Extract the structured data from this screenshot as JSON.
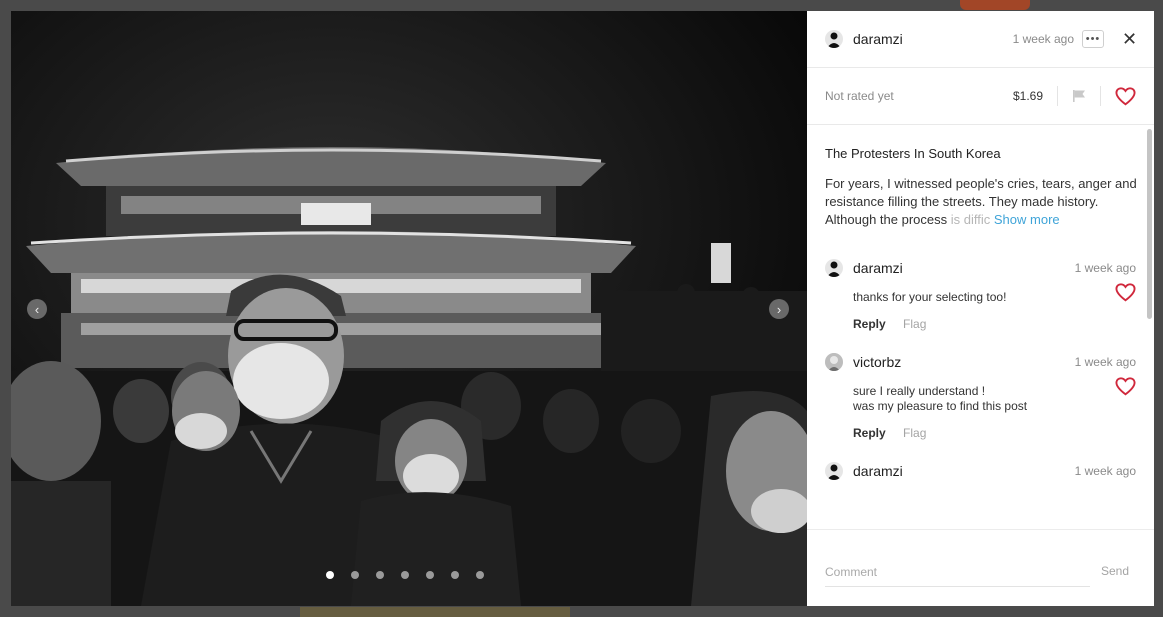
{
  "header": {
    "username": "daramzi",
    "time": "1 week ago",
    "more_label": "•••",
    "close_label": "✕"
  },
  "stats": {
    "rating": "Not rated yet",
    "price": "$1.69"
  },
  "photo": {
    "title": "The Protesters In South Korea",
    "description_visible": "For years, I witnessed people's cries, tears, anger and resistance filling the streets. They made history. Although the process ",
    "description_faded": "is diffic",
    "show_more": "Show more",
    "slide_count": 7,
    "active_slide": 1,
    "prev_label": "‹",
    "next_label": "›"
  },
  "comments": [
    {
      "username": "daramzi",
      "time": "1 week ago",
      "lines": [
        "thanks for your selecting too!"
      ],
      "reply_label": "Reply",
      "flag_label": "Flag"
    },
    {
      "username": "victorbz",
      "time": "1 week ago",
      "lines": [
        "sure I really understand !",
        "was my pleasure to find this post"
      ],
      "reply_label": "Reply",
      "flag_label": "Flag"
    },
    {
      "username": "daramzi",
      "time": "1 week ago",
      "lines": [],
      "reply_label": "",
      "flag_label": ""
    }
  ],
  "footer": {
    "comment_placeholder": "Comment",
    "send_label": "Send"
  },
  "colors": {
    "accent_red": "#d0283c",
    "link_blue": "#3fa4d8",
    "muted_text": "#8a8a8a"
  },
  "icons": {
    "more": "more-dots-icon",
    "close": "close-icon",
    "flag": "flag-icon",
    "heart": "heart-outline-icon",
    "prev": "chevron-left-icon",
    "next": "chevron-right-icon"
  }
}
